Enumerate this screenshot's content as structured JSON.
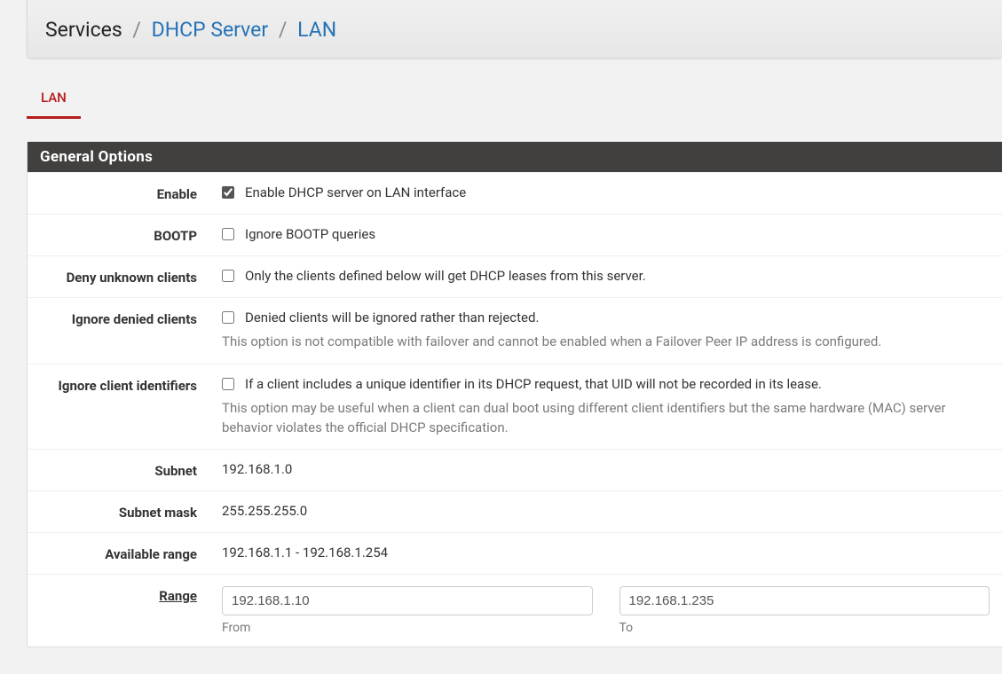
{
  "breadcrumb": {
    "root": "Services",
    "items": [
      "DHCP Server",
      "LAN"
    ]
  },
  "tabs": [
    {
      "label": "LAN",
      "active": true
    }
  ],
  "panel": {
    "title": "General Options"
  },
  "form": {
    "enable": {
      "label": "Enable",
      "checked": true,
      "text": "Enable DHCP server on LAN interface"
    },
    "bootp": {
      "label": "BOOTP",
      "checked": false,
      "text": "Ignore BOOTP queries"
    },
    "deny_unknown": {
      "label": "Deny unknown clients",
      "checked": false,
      "text": "Only the clients defined below will get DHCP leases from this server."
    },
    "ignore_denied": {
      "label": "Ignore denied clients",
      "checked": false,
      "text": "Denied clients will be ignored rather than rejected.",
      "help": "This option is not compatible with failover and cannot be enabled when a Failover Peer IP address is configured."
    },
    "ignore_cid": {
      "label": "Ignore client identifiers",
      "checked": false,
      "text": "If a client includes a unique identifier in its DHCP request, that UID will not be recorded in its lease.",
      "help": "This option may be useful when a client can dual boot using different client identifiers but the same hardware (MAC) server behavior violates the official DHCP specification."
    },
    "subnet": {
      "label": "Subnet",
      "value": "192.168.1.0"
    },
    "subnet_mask": {
      "label": "Subnet mask",
      "value": "255.255.255.0"
    },
    "available_range": {
      "label": "Available range",
      "value": "192.168.1.1 - 192.168.1.254"
    },
    "range": {
      "label": "Range",
      "from_value": "192.168.1.10",
      "from_sub": "From",
      "to_value": "192.168.1.235",
      "to_sub": "To"
    }
  }
}
